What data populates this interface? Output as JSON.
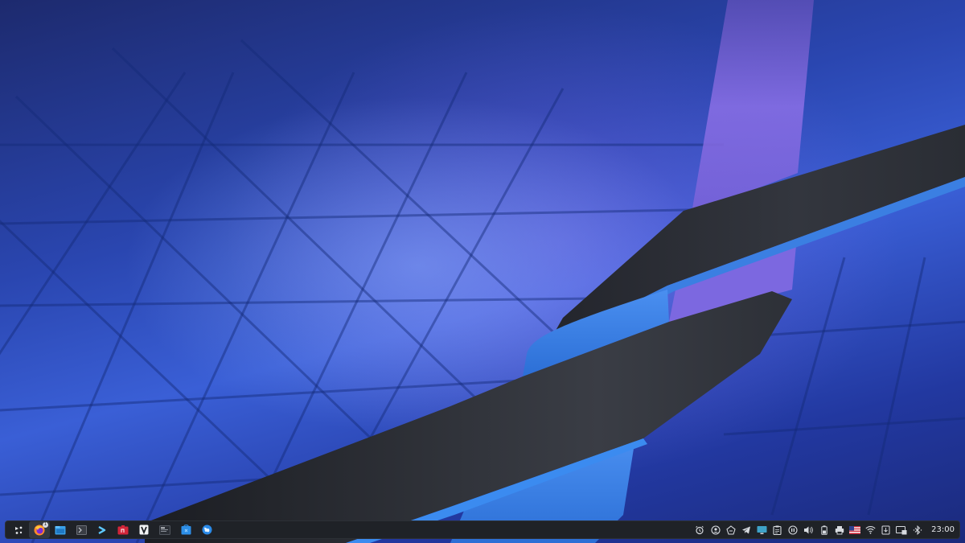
{
  "taskbar": {
    "launchers": [
      {
        "name": "application-launcher-icon",
        "active": false
      },
      {
        "name": "firefox-icon",
        "active": true,
        "badge": "1"
      },
      {
        "name": "file-manager-icon",
        "active": false
      },
      {
        "name": "terminal-icon",
        "active": false
      },
      {
        "name": "konsole-prompt-icon",
        "active": false
      },
      {
        "name": "red-app-icon",
        "active": false
      },
      {
        "name": "text-editor-icon",
        "active": false
      },
      {
        "name": "system-monitor-icon",
        "active": false
      },
      {
        "name": "discover-store-icon",
        "active": false
      },
      {
        "name": "browser-globe-icon",
        "active": false
      }
    ],
    "tray": [
      "alarm-icon",
      "user-sync-icon",
      "vault-icon",
      "telegram-icon",
      "display-icon",
      "clipboard-icon",
      "pause-icon",
      "volume-icon",
      "battery-icon",
      "printer-icon",
      "keyboard-layout-us-flag-icon",
      "wifi-icon",
      "storage-device-icon",
      "network-icon",
      "bluetooth-icon"
    ],
    "clock": "23:00"
  },
  "colors": {
    "panel_bg": "#1f2227",
    "accent_blue": "#3d8ee8",
    "wallpaper_dark": "#1d2a6e",
    "wallpaper_light": "#6e8cf0",
    "ribbon_purple": "#7a62d8",
    "ribbon_dark": "#2a2d35"
  }
}
